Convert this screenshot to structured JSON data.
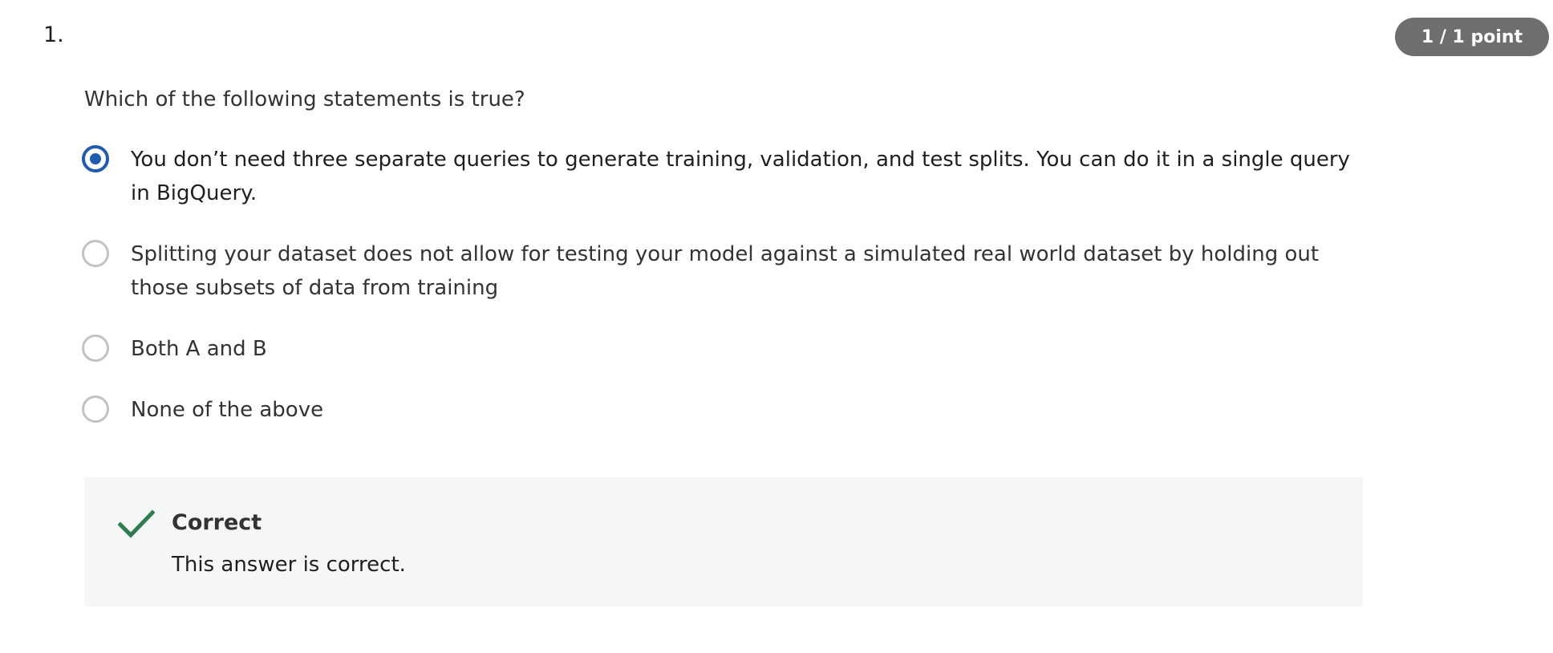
{
  "question": {
    "number": "1.",
    "points": "1 / 1 point",
    "prompt": "Which of the following statements is true?",
    "options": [
      {
        "label": "You don’t need three separate queries to generate training, validation, and test splits. You can do it in a single query in BigQuery.",
        "selected": true
      },
      {
        "label": "Splitting your dataset does not allow for testing your model against a simulated real world dataset by holding out those subsets of data from training",
        "selected": false
      },
      {
        "label": "Both A and B",
        "selected": false
      },
      {
        "label": "None of the above",
        "selected": false
      }
    ]
  },
  "feedback": {
    "icon": "checkmark-icon",
    "title": "Correct",
    "message": "This answer is correct.",
    "color": "#2e7d4f"
  },
  "colors": {
    "selected_radio": "#1f5bb0",
    "badge_background": "#6e6e6e"
  }
}
